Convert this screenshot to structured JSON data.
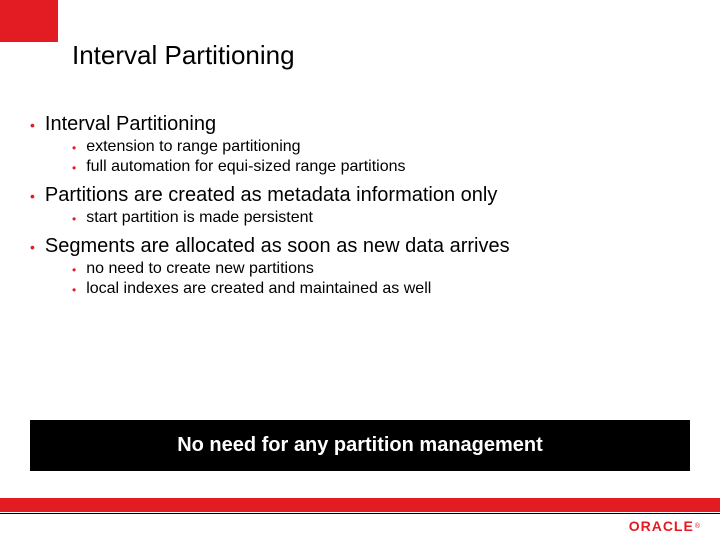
{
  "title": "Interval Partitioning",
  "bullets": {
    "b0": "Interval Partitioning",
    "b0_0": "extension to range partitioning",
    "b0_1": "full automation for equi-sized range partitions",
    "b1": "Partitions are created as metadata information only",
    "b1_0": "start partition is made persistent",
    "b2": "Segments are allocated as soon as new data arrives",
    "b2_0": "no need to create new partitions",
    "b2_1": "local indexes are created and maintained as well"
  },
  "banner": "No need for any partition management",
  "logo": "ORACLE",
  "colors": {
    "accent": "#e31b23"
  }
}
